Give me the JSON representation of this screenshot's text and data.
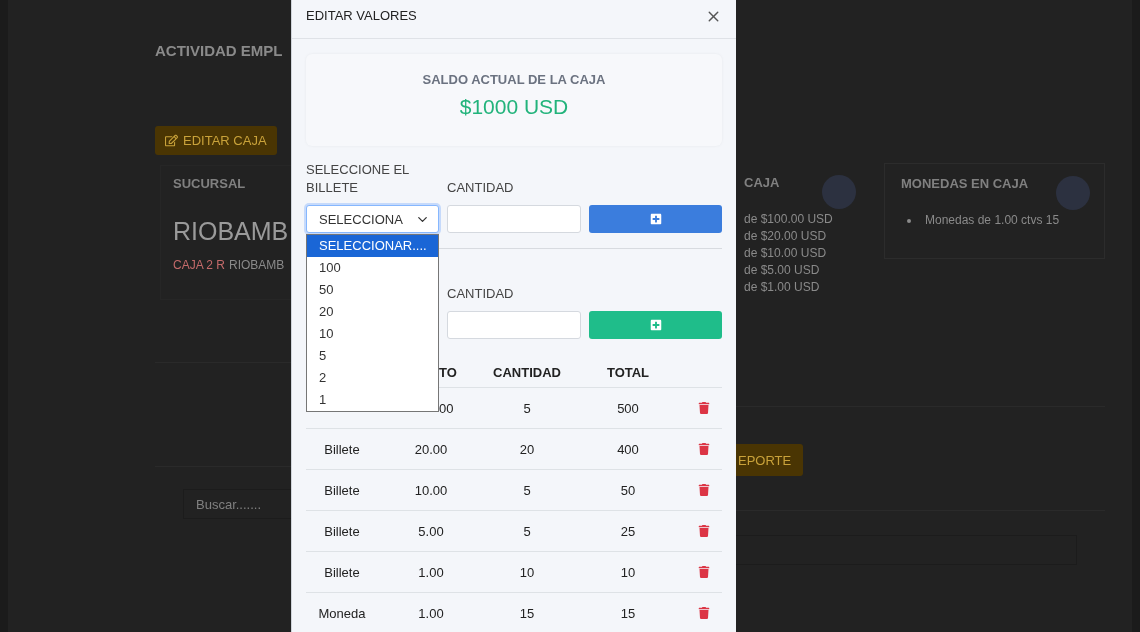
{
  "background": {
    "title": "ACTIVIDAD EMPL",
    "edit_button": "EDITAR CAJA",
    "branch_label": "SUCURSAL",
    "branch_name": "RIOBAMB",
    "branch_code": "CAJA 2 R",
    "branch_city": "RIOBAMB",
    "bills_title": "CAJA",
    "bills": [
      "de $100.00 USD",
      "de $20.00 USD",
      "de $10.00 USD",
      "de $5.00 USD",
      "de $1.00 USD"
    ],
    "coins_title": "MONEDAS EN CAJA",
    "coins": [
      "Monedas de 1.00 ctvs 15"
    ],
    "report_button": "EPORTE",
    "search": {
      "placeholder": "Buscar......."
    }
  },
  "modal": {
    "title": "EDITAR VALORES",
    "balance_label": "SALDO ACTUAL DE LA CAJA",
    "balance": "$1000 USD",
    "bill_form": {
      "label": "SELECCIONE EL BILLETE",
      "select_value": "SELECCIONA",
      "expanded": true,
      "quantity_label": "CANTIDAD",
      "options": [
        {
          "label": "SELECCIONAR....",
          "selected": true
        },
        {
          "label": "100",
          "selected": false
        },
        {
          "label": "50",
          "selected": false
        },
        {
          "label": "20",
          "selected": false
        },
        {
          "label": "10",
          "selected": false
        },
        {
          "label": "5",
          "selected": false
        },
        {
          "label": "2",
          "selected": false
        },
        {
          "label": "1",
          "selected": false
        }
      ]
    },
    "coin_form": {
      "quantity_label": "CANTIDAD"
    },
    "table": {
      "header": {
        "cells": [
          null,
          "TO",
          "CANTIDAD",
          "TOTAL"
        ],
        "cut": true
      },
      "rows": [
        {
          "cells": [
            null,
            "00",
            "5",
            "500"
          ],
          "cut": true
        },
        {
          "cells": [
            "Billete",
            "20.00",
            "20",
            "400"
          ],
          "cut": false
        },
        {
          "cells": [
            "Billete",
            "10.00",
            "5",
            "50"
          ],
          "cut": false
        },
        {
          "cells": [
            "Billete",
            "5.00",
            "5",
            "25"
          ],
          "cut": false
        },
        {
          "cells": [
            "Billete",
            "1.00",
            "10",
            "10"
          ],
          "cut": false
        },
        {
          "cells": [
            "Moneda",
            "1.00",
            "15",
            "15"
          ],
          "cut": false
        }
      ]
    }
  }
}
